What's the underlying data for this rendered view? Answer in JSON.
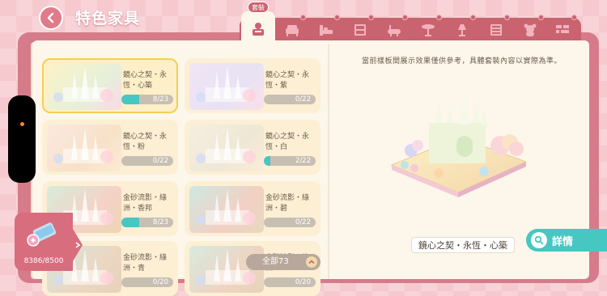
{
  "header": {
    "title": "特色家具"
  },
  "tabs": {
    "active_badge": "套裝",
    "items": [
      "outfit-icon",
      "sofa-icon",
      "bed-icon",
      "cabinet-icon",
      "bathtub-icon",
      "table-icon",
      "lamp-icon",
      "drawer-icon",
      "plush-icon",
      "wall-icon"
    ]
  },
  "sets": [
    {
      "name": "鏡心之契・永恆・心築",
      "progress": "8/23",
      "fraction": 0.35,
      "selected": true,
      "palette": [
        "#fcf3c8",
        "#e6f0d8",
        "#fbd9e6"
      ]
    },
    {
      "name": "鏡心之契・永恆・紫",
      "progress": "0/22",
      "fraction": 0,
      "selected": false,
      "palette": [
        "#f0e6f5",
        "#e7e2f3",
        "#fbe0ea"
      ]
    },
    {
      "name": "鏡心之契・永恆・粉",
      "progress": "0/22",
      "fraction": 0,
      "selected": false,
      "palette": [
        "#fbe9e0",
        "#f7e1c8",
        "#fde9d6"
      ]
    },
    {
      "name": "鏡心之契・永恆・白",
      "progress": "2/22",
      "fraction": 0.09,
      "selected": false,
      "palette": [
        "#f5efe0",
        "#efe7d5",
        "#fbecd8"
      ]
    },
    {
      "name": "金砂流影・綠洲・香邦",
      "progress": "8/23",
      "fraction": 0.35,
      "selected": false,
      "palette": [
        "#d7ecd9",
        "#f4d2c6",
        "#eed5b3"
      ]
    },
    {
      "name": "金砂流影・綠洲・碧",
      "progress": "0/22",
      "fraction": 0,
      "selected": false,
      "palette": [
        "#cde9e2",
        "#f2d0c3",
        "#e7d9c0"
      ]
    },
    {
      "name": "金砂流影・綠洲・青",
      "progress": "0/20",
      "fraction": 0,
      "selected": false,
      "palette": [
        "#d2e6df",
        "#ecd7c2",
        "#e6d1bb"
      ]
    },
    {
      "name": "金砂流影・綠洲",
      "progress": "0/20",
      "fraction": 0,
      "selected": false,
      "palette": [
        "#d7ebe0",
        "#eed4c2",
        "#e7d3bb"
      ]
    }
  ],
  "filter": {
    "label": "全部73"
  },
  "detail": {
    "notice": "當前樣板間展示效果僅供參考，具體套裝內容以實際為準。",
    "set_name": "鏡心之契・永恆・心築",
    "details_label": "詳情"
  },
  "points": {
    "value": "8386/8500"
  },
  "colors": {
    "accent": "#46c7c1",
    "frame": "#c9636f",
    "page": "#fdf6ea",
    "selected": "#f5cf53"
  }
}
